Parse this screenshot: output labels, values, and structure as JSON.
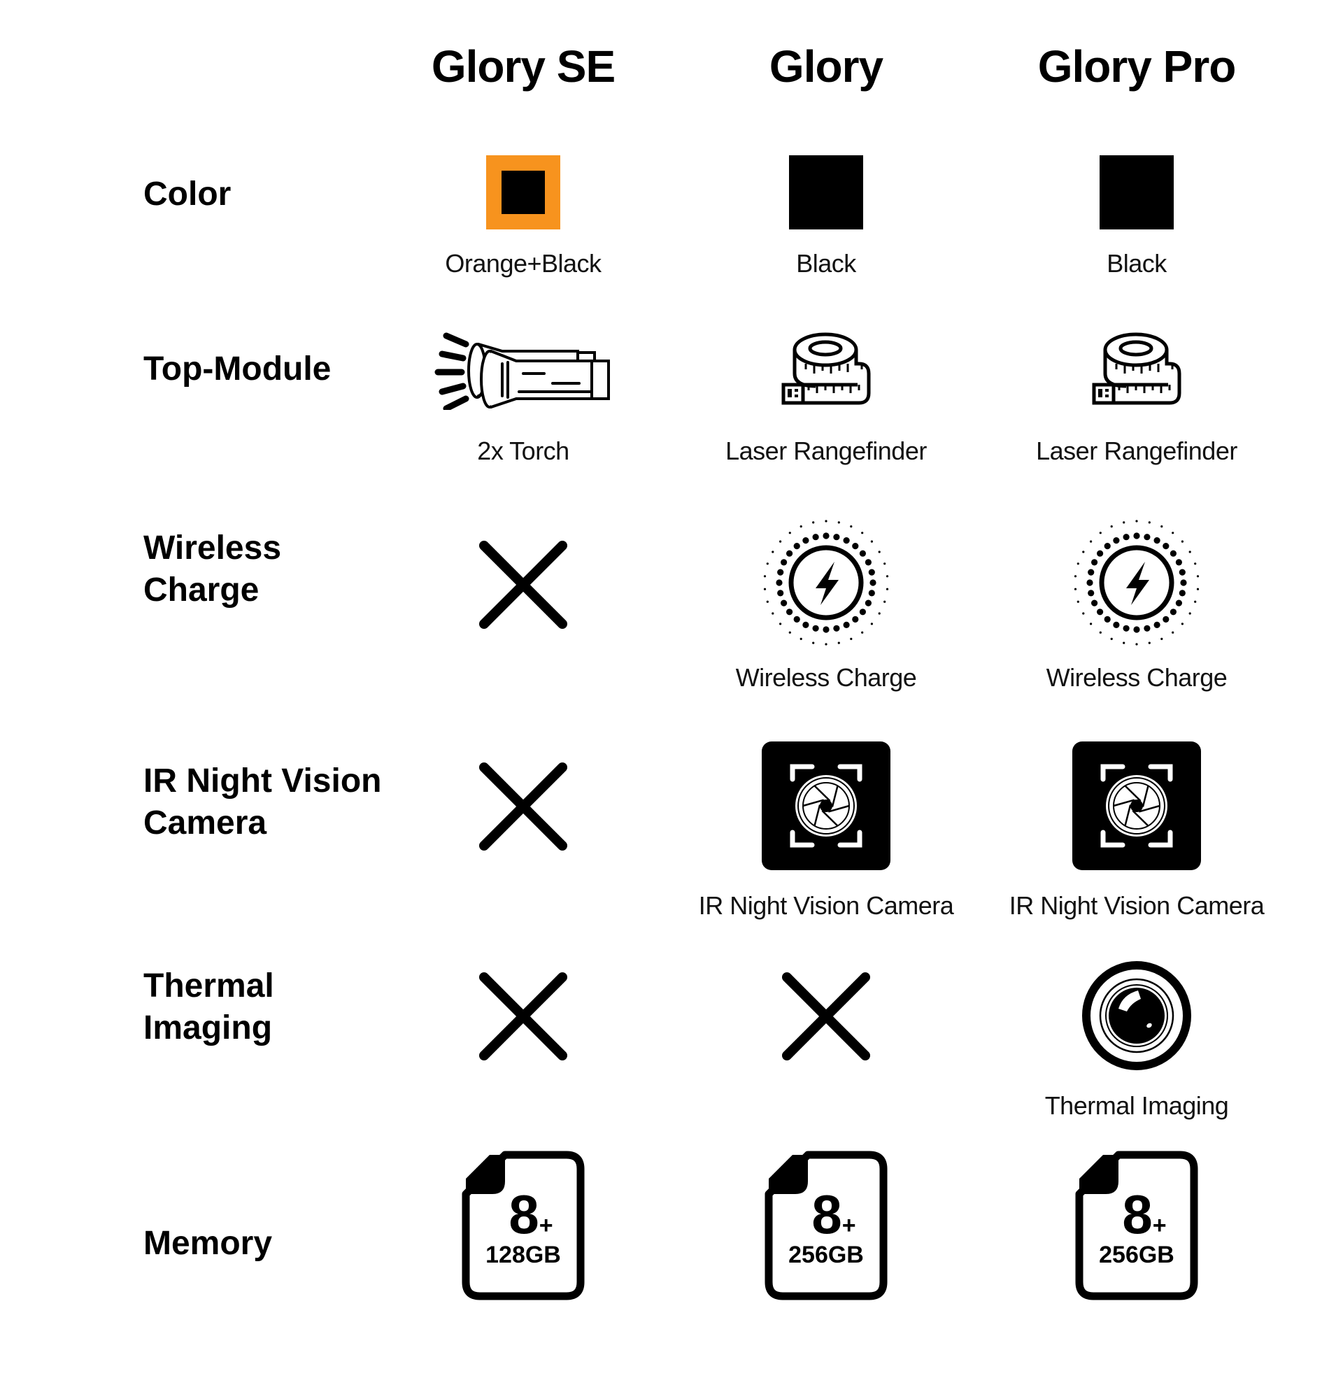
{
  "models": [
    {
      "name": "Glory SE"
    },
    {
      "name": "Glory"
    },
    {
      "name": "Glory Pro"
    }
  ],
  "colors": {
    "orange": "#F7931E",
    "black": "#000000"
  },
  "rows": {
    "color": {
      "label": "Color",
      "cells": [
        {
          "swatch": "orange-black",
          "caption": "Orange+Black"
        },
        {
          "swatch": "black",
          "caption": "Black"
        },
        {
          "swatch": "black",
          "caption": "Black"
        }
      ]
    },
    "top_module": {
      "label": "Top-Module",
      "cells": [
        {
          "icon": "torch-icon",
          "caption": "2x Torch"
        },
        {
          "icon": "tape-measure-icon",
          "caption": "Laser Rangefinder"
        },
        {
          "icon": "tape-measure-icon",
          "caption": "Laser Rangefinder"
        }
      ]
    },
    "wireless_charge": {
      "label_line1": "Wireless",
      "label_line2": "Charge",
      "cells": [
        {
          "icon": "not-available-icon",
          "caption": ""
        },
        {
          "icon": "wireless-charge-icon",
          "caption": "Wireless Charge"
        },
        {
          "icon": "wireless-charge-icon",
          "caption": "Wireless Charge"
        }
      ]
    },
    "ir_night_vision": {
      "label_line1": "IR Night Vision",
      "label_line2": "Camera",
      "cells": [
        {
          "icon": "not-available-icon",
          "caption": ""
        },
        {
          "icon": "camera-aperture-icon",
          "caption": "IR Night Vision Camera"
        },
        {
          "icon": "camera-aperture-icon",
          "caption": "IR Night Vision Camera"
        }
      ]
    },
    "thermal_imaging": {
      "label_line1": "Thermal",
      "label_line2": "Imaging",
      "cells": [
        {
          "icon": "not-available-icon",
          "caption": ""
        },
        {
          "icon": "not-available-icon",
          "caption": ""
        },
        {
          "icon": "thermal-lens-icon",
          "caption": "Thermal Imaging"
        }
      ]
    },
    "memory": {
      "label": "Memory",
      "cells": [
        {
          "icon": "memory-card-icon",
          "ram": "8",
          "ram_suffix": "+",
          "storage": "128GB"
        },
        {
          "icon": "memory-card-icon",
          "ram": "8",
          "ram_suffix": "+",
          "storage": "256GB"
        },
        {
          "icon": "memory-card-icon",
          "ram": "8",
          "ram_suffix": "+",
          "storage": "256GB"
        }
      ]
    }
  }
}
